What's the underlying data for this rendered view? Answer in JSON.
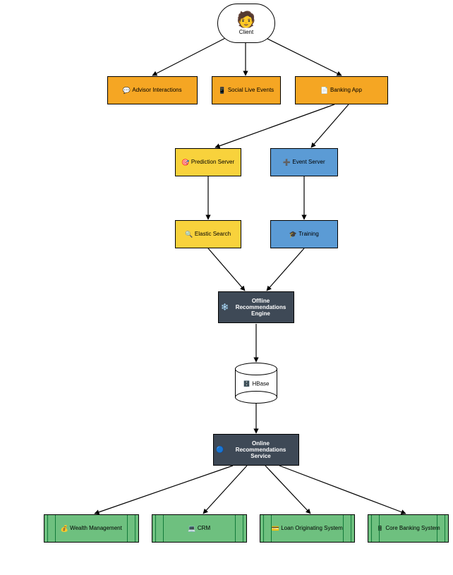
{
  "nodes": {
    "client": {
      "label": "Client"
    },
    "advisor": {
      "label": "Advisor Interactions"
    },
    "social": {
      "label": "Social Live Events"
    },
    "banking": {
      "label": "Banking App"
    },
    "prediction": {
      "label": "Prediction Server"
    },
    "event": {
      "label": "Event Server"
    },
    "elastic": {
      "label": "Elastic Search"
    },
    "training": {
      "label": "Training"
    },
    "offline": {
      "label": "Offline\nRecommendations Engine"
    },
    "hbase": {
      "label": "HBase"
    },
    "online": {
      "label": "Online\nRecommendations Service"
    },
    "wealth": {
      "label": "Wealth Management"
    },
    "crm": {
      "label": "CRM"
    },
    "loan": {
      "label": "Loan Originating System"
    },
    "core": {
      "label": "Core Banking System"
    }
  },
  "edges": [
    [
      "client",
      "advisor"
    ],
    [
      "client",
      "social"
    ],
    [
      "client",
      "banking"
    ],
    [
      "banking",
      "prediction"
    ],
    [
      "banking",
      "event"
    ],
    [
      "prediction",
      "elastic"
    ],
    [
      "event",
      "training"
    ],
    [
      "elastic",
      "offline"
    ],
    [
      "training",
      "offline"
    ],
    [
      "offline",
      "hbase"
    ],
    [
      "hbase",
      "online"
    ],
    [
      "online",
      "wealth"
    ],
    [
      "online",
      "crm"
    ],
    [
      "online",
      "loan"
    ],
    [
      "online",
      "core"
    ]
  ],
  "palette": {
    "orange": "#F5A623",
    "yellow": "#F8D23C",
    "blue": "#5B9BD5",
    "dark": "#3E4956",
    "green": "#6EC07F"
  }
}
